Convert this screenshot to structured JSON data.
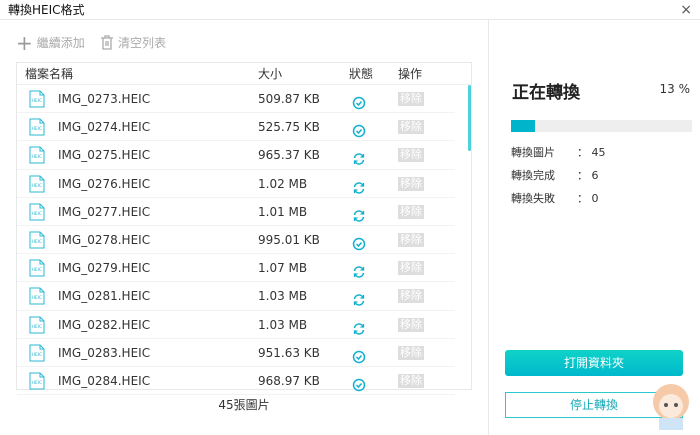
{
  "window": {
    "title": "轉換HEIC格式",
    "close": "×"
  },
  "toolbar": {
    "add": "繼續添加",
    "clear": "清空列表"
  },
  "table": {
    "headers": {
      "name": "檔案名稱",
      "size": "大小",
      "status": "狀態",
      "action": "操作"
    },
    "rows": [
      {
        "name": "IMG_0273.HEIC",
        "size": "509.87 KB",
        "status": "done",
        "action": "移除"
      },
      {
        "name": "IMG_0274.HEIC",
        "size": "525.75 KB",
        "status": "done",
        "action": "移除"
      },
      {
        "name": "IMG_0275.HEIC",
        "size": "965.37 KB",
        "status": "converting",
        "action": "移除"
      },
      {
        "name": "IMG_0276.HEIC",
        "size": "1.02 MB",
        "status": "converting",
        "action": "移除"
      },
      {
        "name": "IMG_0277.HEIC",
        "size": "1.01 MB",
        "status": "converting",
        "action": "移除"
      },
      {
        "name": "IMG_0278.HEIC",
        "size": "995.01 KB",
        "status": "done",
        "action": "移除"
      },
      {
        "name": "IMG_0279.HEIC",
        "size": "1.07 MB",
        "status": "converting",
        "action": "移除"
      },
      {
        "name": "IMG_0281.HEIC",
        "size": "1.03 MB",
        "status": "converting",
        "action": "移除"
      },
      {
        "name": "IMG_0282.HEIC",
        "size": "1.03 MB",
        "status": "converting",
        "action": "移除"
      },
      {
        "name": "IMG_0283.HEIC",
        "size": "951.63 KB",
        "status": "done",
        "action": "移除"
      },
      {
        "name": "IMG_0284.HEIC",
        "size": "968.97 KB",
        "status": "done",
        "action": "移除"
      }
    ],
    "footer": "45張圖片"
  },
  "progress": {
    "title": "正在轉換",
    "percent_label": "13 %",
    "percent": 13,
    "stats": [
      {
        "label": "轉換圖片",
        "value": "： 45"
      },
      {
        "label": "轉換完成",
        "value": "： 6"
      },
      {
        "label": "轉換失敗",
        "value": "： 0"
      }
    ]
  },
  "buttons": {
    "open_folder": "打開資料夾",
    "stop": "停止轉換"
  },
  "colors": {
    "accent": "#00b4cc"
  }
}
